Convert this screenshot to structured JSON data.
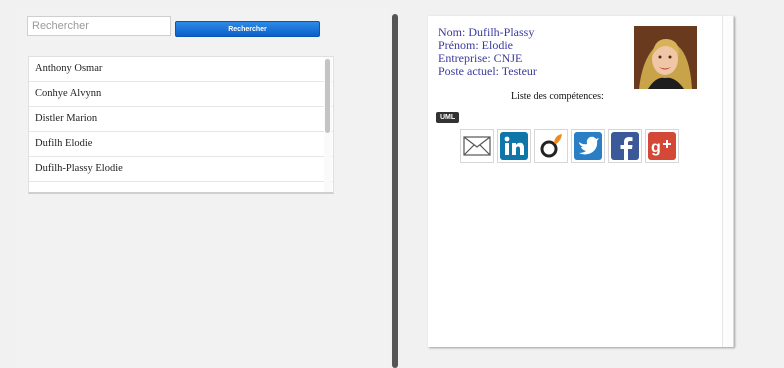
{
  "search": {
    "placeholder": "Rechercher",
    "button_label": "Rechercher"
  },
  "people": [
    "Anthony Osmar",
    "Conhye Alvynn",
    "Distler Marion",
    "Dufilh Elodie",
    "Dufilh-Plassy Elodie"
  ],
  "profile": {
    "nom": "Nom: Dufilh-Plassy",
    "prenom": "Prénom: Elodie",
    "entreprise": "Entreprise: CNJE",
    "poste": "Poste actuel: Testeur",
    "skills_title": "Liste des compétences:",
    "skills": [
      "UML"
    ]
  },
  "social_icons": [
    "mail-icon",
    "linkedin-icon",
    "viadeo-icon",
    "twitter-icon",
    "facebook-icon",
    "google-plus-icon"
  ],
  "colors": {
    "accent_button": "#0a5fc8",
    "profile_text": "#3a3aa0",
    "linkedin": "#0e76a8",
    "twitter": "#2a7fc4",
    "facebook": "#3b5998",
    "google_plus": "#d34836"
  }
}
